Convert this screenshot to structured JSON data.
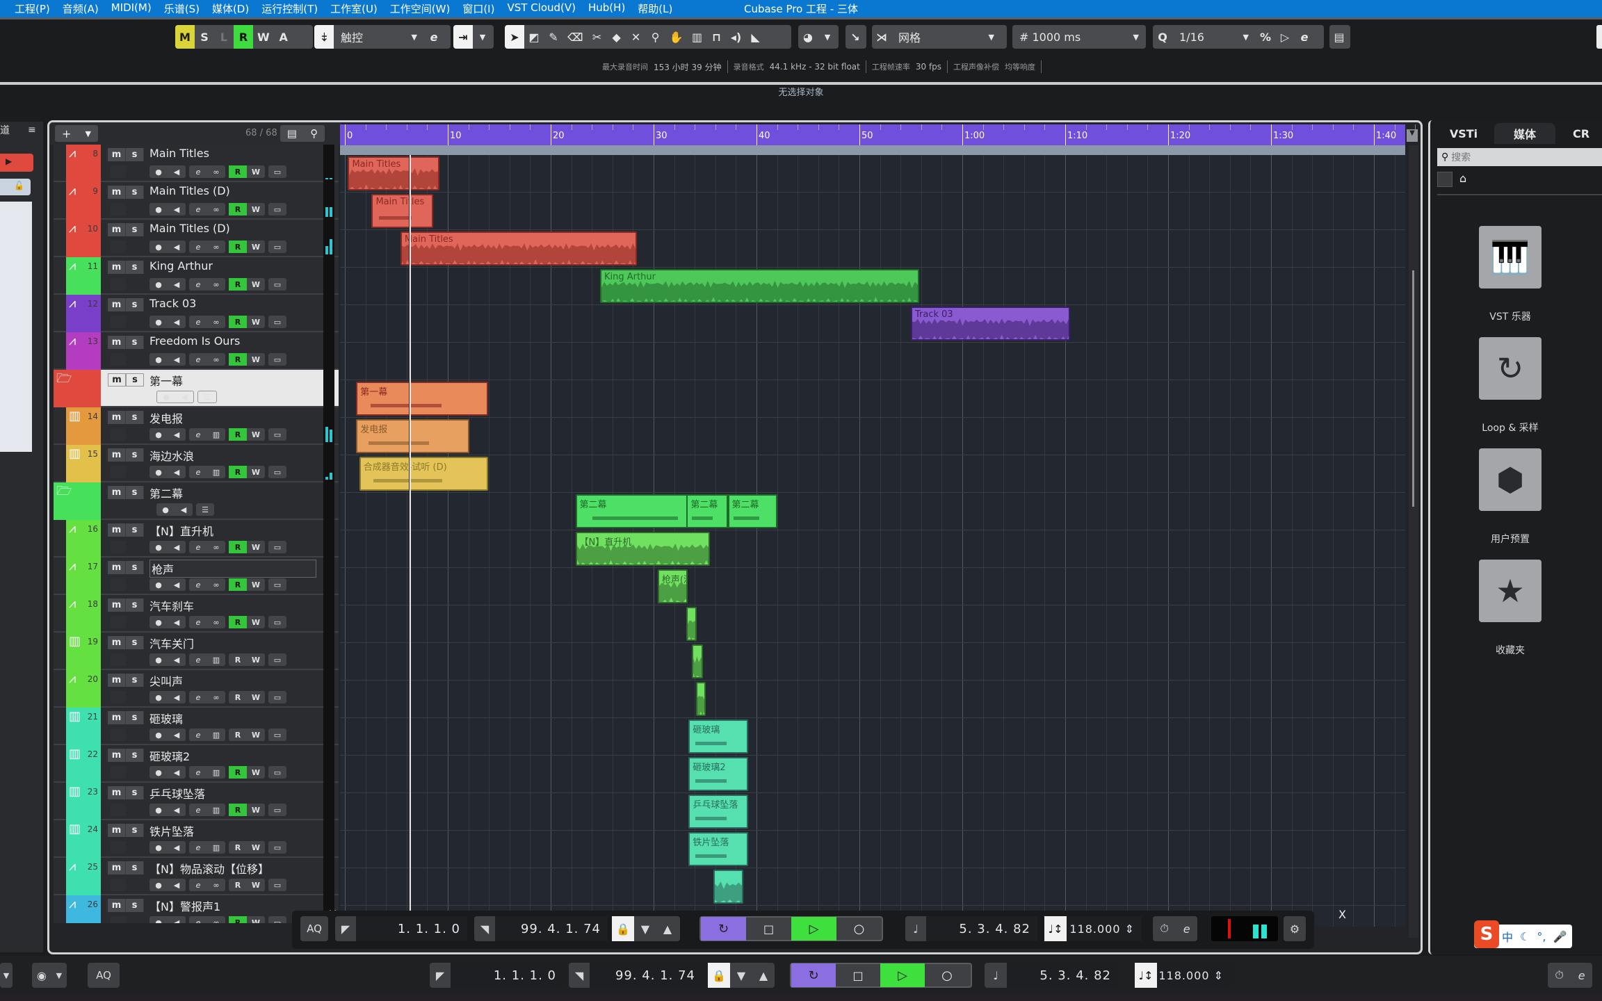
{
  "menu": {
    "items": [
      "工程(P)",
      "音频(A)",
      "MIDI(M)",
      "乐谱(S)",
      "媒体(D)",
      "运行控制(T)",
      "工作室(U)",
      "工作空间(W)",
      "窗口(I)",
      "VST Cloud(V)",
      "Hub(H)",
      "帮助(L)"
    ],
    "title": "Cubase Pro 工程 - 三体"
  },
  "toolbar": {
    "mode_buttons": [
      "M",
      "S",
      "L",
      "R",
      "W",
      "A"
    ],
    "automation_mode": "触控",
    "snap_type": "网格",
    "grid_value": "1000 ms",
    "quantize_label": "Q",
    "quantize_value": "1/16"
  },
  "status": {
    "max_rec_label": "最大录音时间",
    "max_rec_value": "153 小时 39 分钟",
    "rec_format_label": "录音格式",
    "rec_format_value": "44.1 kHz - 32 bit float",
    "frame_rate_label": "工程帧速率",
    "frame_rate_value": "30 fps",
    "delay_comp_label": "工程声像补偿",
    "loudness_label": "均等响度"
  },
  "info_line": "无选择对象",
  "tracklist": {
    "count": "68 / 68",
    "tracks": [
      {
        "num": "8",
        "name": "Main Titles",
        "type": "audio",
        "color": "#e0493d",
        "read": true,
        "meter": [
          2,
          2
        ]
      },
      {
        "num": "9",
        "name": "Main Titles (D)",
        "type": "audio",
        "color": "#e0493d",
        "read": true,
        "meter": [
          14,
          14
        ]
      },
      {
        "num": "10",
        "name": "Main Titles (D)",
        "type": "audio",
        "color": "#e0493d",
        "read": true,
        "meter": [
          12,
          22
        ]
      },
      {
        "num": "11",
        "name": "King Arthur",
        "type": "audio",
        "color": "#46e05a",
        "read": true,
        "meter": []
      },
      {
        "num": "12",
        "name": "Track 03",
        "type": "audio",
        "color": "#7a3fc8",
        "read": true,
        "meter": []
      },
      {
        "num": "13",
        "name": "Freedom Is Ours",
        "type": "audio",
        "color": "#b43cc0",
        "read": true,
        "meter": []
      },
      {
        "num": "",
        "name": "第一幕",
        "type": "folder",
        "color": "#e0493d",
        "active": true
      },
      {
        "num": "14",
        "name": "发电报",
        "type": "instrument",
        "color": "#e49a3c",
        "read": true,
        "meter": [
          22,
          18
        ]
      },
      {
        "num": "15",
        "name": "海边水浪",
        "type": "instrument",
        "color": "#e2c04a",
        "read": true,
        "meter": [
          4,
          10
        ]
      },
      {
        "num": "",
        "name": "第二幕",
        "type": "folder",
        "color": "#46e05a",
        "active": false
      },
      {
        "num": "16",
        "name": "【N】直升机",
        "type": "audio",
        "color": "#64e040",
        "read": true,
        "meter": []
      },
      {
        "num": "17",
        "name": "枪声",
        "type": "audio",
        "color": "#64e040",
        "read": true,
        "meter": [],
        "editing": true
      },
      {
        "num": "18",
        "name": "汽车刹车",
        "type": "audio",
        "color": "#64e040",
        "read": true,
        "meter": []
      },
      {
        "num": "19",
        "name": "汽车关门",
        "type": "instrument",
        "color": "#64e040",
        "read": false,
        "meter": []
      },
      {
        "num": "20",
        "name": "尖叫声",
        "type": "audio",
        "color": "#64e040",
        "read": false,
        "meter": []
      },
      {
        "num": "21",
        "name": "砸玻璃",
        "type": "instrument",
        "color": "#3fe0b0",
        "read": false,
        "meter": []
      },
      {
        "num": "22",
        "name": "砸玻璃2",
        "type": "instrument",
        "color": "#3fe0b0",
        "read": true,
        "meter": []
      },
      {
        "num": "23",
        "name": "乒乓球坠落",
        "type": "instrument",
        "color": "#3fe0b0",
        "read": true,
        "meter": []
      },
      {
        "num": "24",
        "name": "铁片坠落",
        "type": "instrument",
        "color": "#3fe0b0",
        "read": false,
        "meter": []
      },
      {
        "num": "25",
        "name": "【N】物品滚动【位移】",
        "type": "audio",
        "color": "#3fe0b0",
        "read": false,
        "meter": []
      },
      {
        "num": "26",
        "name": "【N】警报声1",
        "type": "audio",
        "color": "#3fb8e0",
        "read": true,
        "meter": []
      }
    ]
  },
  "ruler": {
    "labels": [
      "0",
      "10",
      "20",
      "30",
      "40",
      "50",
      "1:00",
      "1:10",
      "1:20",
      "1:30",
      "1:40"
    ],
    "seconds": [
      0,
      10,
      20,
      30,
      40,
      50,
      60,
      70,
      80,
      90,
      100
    ]
  },
  "playhead_seconds": 6.2,
  "clips": [
    {
      "row": 0,
      "label": "Main Titles",
      "start": 0.3,
      "end": 9.2,
      "color": "#e0665a",
      "dark": "#8a2a24",
      "wave": true
    },
    {
      "row": 1,
      "label": "Main Titles",
      "start": 2.6,
      "end": 8.6,
      "color": "#e0665a",
      "dark": "#8a2a24",
      "wave": false
    },
    {
      "row": 2,
      "label": "Main Titles",
      "start": 5.4,
      "end": 28.4,
      "color": "#e0665a",
      "dark": "#8a2a24",
      "wave": true
    },
    {
      "row": 3,
      "label": "King Arthur",
      "start": 24.8,
      "end": 55.8,
      "color": "#4fc85a",
      "dark": "#1f6a2a",
      "wave": true
    },
    {
      "row": 4,
      "label": "Track 03",
      "start": 55.0,
      "end": 70.5,
      "color": "#8a5ad0",
      "dark": "#3a1f6a",
      "wave": true
    },
    {
      "row": 6,
      "label": "第一幕",
      "start": 1.1,
      "end": 13.9,
      "color": "#e88a5a",
      "dark": "#8a2a24",
      "wave": false
    },
    {
      "row": 7,
      "label": "发电报",
      "start": 1.1,
      "end": 12.1,
      "color": "#e8a060",
      "dark": "#8a5a2a",
      "wave": false
    },
    {
      "row": 8,
      "label": "合成器音效-试听 (D)",
      "start": 1.4,
      "end": 13.9,
      "color": "#e4c458",
      "dark": "#8a7a2a",
      "wave": false
    },
    {
      "row": 9,
      "label": "第二幕",
      "start": 22.4,
      "end": 37.8,
      "color": "#4ee066",
      "dark": "#1f6a2a",
      "wave": false
    },
    {
      "row": 9,
      "label": "第二幕",
      "start": 33.2,
      "end": 37.2,
      "color": "#4ee066",
      "dark": "#1f6a2a",
      "wave": false
    },
    {
      "row": 9,
      "label": "第二幕",
      "start": 37.2,
      "end": 42.0,
      "color": "#4ee066",
      "dark": "#1f6a2a",
      "wave": false
    },
    {
      "row": 10,
      "label": "【N】直升机",
      "start": 22.4,
      "end": 35.5,
      "color": "#6fe060",
      "dark": "#2f6a2a",
      "wave": true
    },
    {
      "row": 11,
      "label": "枪声(清脆",
      "start": 30.4,
      "end": 33.3,
      "color": "#6fe060",
      "dark": "#2f6a2a",
      "wave": true
    },
    {
      "row": 12,
      "label": "",
      "start": 33.2,
      "end": 34.2,
      "color": "#6fe060",
      "dark": "#2f6a2a",
      "wave": true
    },
    {
      "row": 13,
      "label": "",
      "start": 33.7,
      "end": 34.8,
      "color": "#6fe060",
      "dark": "#2f6a2a",
      "wave": true
    },
    {
      "row": 14,
      "label": "",
      "start": 34.1,
      "end": 35.1,
      "color": "#6fe060",
      "dark": "#2f6a2a",
      "wave": true
    },
    {
      "row": 15,
      "label": "砸玻璃",
      "start": 33.4,
      "end": 39.2,
      "color": "#56e0b0",
      "dark": "#2a6a5a",
      "wave": false
    },
    {
      "row": 16,
      "label": "砸玻璃2",
      "start": 33.4,
      "end": 39.2,
      "color": "#56e0b0",
      "dark": "#2a6a5a",
      "wave": false
    },
    {
      "row": 17,
      "label": "乒乓球坠落",
      "start": 33.4,
      "end": 39.2,
      "color": "#56e0b0",
      "dark": "#2a6a5a",
      "wave": false
    },
    {
      "row": 18,
      "label": "铁片坠落",
      "start": 33.4,
      "end": 39.2,
      "color": "#56e0b0",
      "dark": "#2a6a5a",
      "wave": false
    },
    {
      "row": 19,
      "label": "",
      "start": 35.8,
      "end": 38.7,
      "color": "#56e0b0",
      "dark": "#2a6a5a",
      "wave": true
    }
  ],
  "transport": {
    "aq": "AQ",
    "left_locator": "1. 1. 1.  0",
    "right_locator": "99. 4. 1. 74",
    "position": "5. 3. 4. 82",
    "tempo": "118.000",
    "close": "X"
  },
  "right_panel": {
    "tabs": [
      "VSTi",
      "媒体",
      "CR"
    ],
    "active_tab": "媒体",
    "search_placeholder": "搜索",
    "items": [
      {
        "label": "VST 乐器",
        "icon": "piano-icon"
      },
      {
        "label": "Loop & 采样",
        "icon": "loop-icon"
      },
      {
        "label": "用户预置",
        "icon": "user-preset-icon"
      },
      {
        "label": "收藏夹",
        "icon": "star-icon"
      }
    ]
  },
  "inspector": {
    "label": "道"
  },
  "ime": {
    "logo": "S",
    "mode": "中"
  }
}
